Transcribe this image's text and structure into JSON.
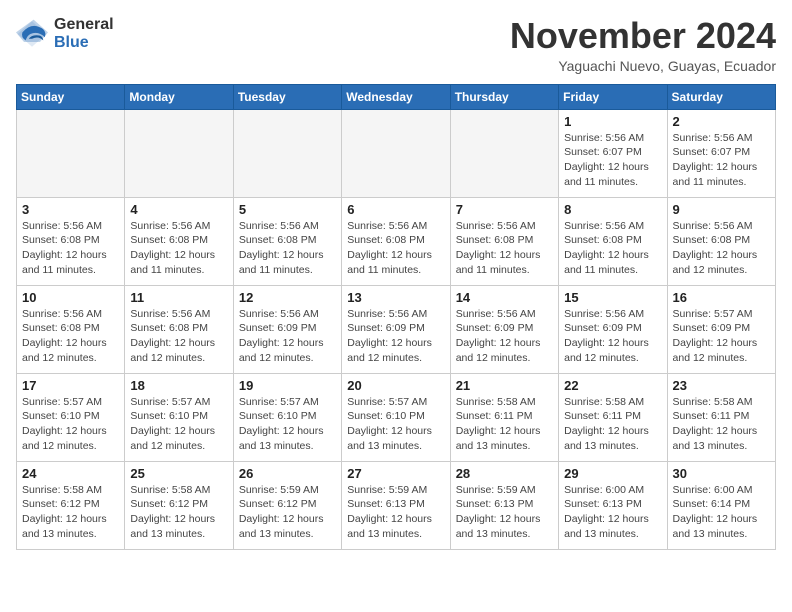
{
  "logo": {
    "general": "General",
    "blue": "Blue"
  },
  "title": "November 2024",
  "location": "Yaguachi Nuevo, Guayas, Ecuador",
  "days_of_week": [
    "Sunday",
    "Monday",
    "Tuesday",
    "Wednesday",
    "Thursday",
    "Friday",
    "Saturday"
  ],
  "weeks": [
    [
      {
        "day": "",
        "info": ""
      },
      {
        "day": "",
        "info": ""
      },
      {
        "day": "",
        "info": ""
      },
      {
        "day": "",
        "info": ""
      },
      {
        "day": "",
        "info": ""
      },
      {
        "day": "1",
        "info": "Sunrise: 5:56 AM\nSunset: 6:07 PM\nDaylight: 12 hours and 11 minutes."
      },
      {
        "day": "2",
        "info": "Sunrise: 5:56 AM\nSunset: 6:07 PM\nDaylight: 12 hours and 11 minutes."
      }
    ],
    [
      {
        "day": "3",
        "info": "Sunrise: 5:56 AM\nSunset: 6:08 PM\nDaylight: 12 hours and 11 minutes."
      },
      {
        "day": "4",
        "info": "Sunrise: 5:56 AM\nSunset: 6:08 PM\nDaylight: 12 hours and 11 minutes."
      },
      {
        "day": "5",
        "info": "Sunrise: 5:56 AM\nSunset: 6:08 PM\nDaylight: 12 hours and 11 minutes."
      },
      {
        "day": "6",
        "info": "Sunrise: 5:56 AM\nSunset: 6:08 PM\nDaylight: 12 hours and 11 minutes."
      },
      {
        "day": "7",
        "info": "Sunrise: 5:56 AM\nSunset: 6:08 PM\nDaylight: 12 hours and 11 minutes."
      },
      {
        "day": "8",
        "info": "Sunrise: 5:56 AM\nSunset: 6:08 PM\nDaylight: 12 hours and 11 minutes."
      },
      {
        "day": "9",
        "info": "Sunrise: 5:56 AM\nSunset: 6:08 PM\nDaylight: 12 hours and 12 minutes."
      }
    ],
    [
      {
        "day": "10",
        "info": "Sunrise: 5:56 AM\nSunset: 6:08 PM\nDaylight: 12 hours and 12 minutes."
      },
      {
        "day": "11",
        "info": "Sunrise: 5:56 AM\nSunset: 6:08 PM\nDaylight: 12 hours and 12 minutes."
      },
      {
        "day": "12",
        "info": "Sunrise: 5:56 AM\nSunset: 6:09 PM\nDaylight: 12 hours and 12 minutes."
      },
      {
        "day": "13",
        "info": "Sunrise: 5:56 AM\nSunset: 6:09 PM\nDaylight: 12 hours and 12 minutes."
      },
      {
        "day": "14",
        "info": "Sunrise: 5:56 AM\nSunset: 6:09 PM\nDaylight: 12 hours and 12 minutes."
      },
      {
        "day": "15",
        "info": "Sunrise: 5:56 AM\nSunset: 6:09 PM\nDaylight: 12 hours and 12 minutes."
      },
      {
        "day": "16",
        "info": "Sunrise: 5:57 AM\nSunset: 6:09 PM\nDaylight: 12 hours and 12 minutes."
      }
    ],
    [
      {
        "day": "17",
        "info": "Sunrise: 5:57 AM\nSunset: 6:10 PM\nDaylight: 12 hours and 12 minutes."
      },
      {
        "day": "18",
        "info": "Sunrise: 5:57 AM\nSunset: 6:10 PM\nDaylight: 12 hours and 12 minutes."
      },
      {
        "day": "19",
        "info": "Sunrise: 5:57 AM\nSunset: 6:10 PM\nDaylight: 12 hours and 13 minutes."
      },
      {
        "day": "20",
        "info": "Sunrise: 5:57 AM\nSunset: 6:10 PM\nDaylight: 12 hours and 13 minutes."
      },
      {
        "day": "21",
        "info": "Sunrise: 5:58 AM\nSunset: 6:11 PM\nDaylight: 12 hours and 13 minutes."
      },
      {
        "day": "22",
        "info": "Sunrise: 5:58 AM\nSunset: 6:11 PM\nDaylight: 12 hours and 13 minutes."
      },
      {
        "day": "23",
        "info": "Sunrise: 5:58 AM\nSunset: 6:11 PM\nDaylight: 12 hours and 13 minutes."
      }
    ],
    [
      {
        "day": "24",
        "info": "Sunrise: 5:58 AM\nSunset: 6:12 PM\nDaylight: 12 hours and 13 minutes."
      },
      {
        "day": "25",
        "info": "Sunrise: 5:58 AM\nSunset: 6:12 PM\nDaylight: 12 hours and 13 minutes."
      },
      {
        "day": "26",
        "info": "Sunrise: 5:59 AM\nSunset: 6:12 PM\nDaylight: 12 hours and 13 minutes."
      },
      {
        "day": "27",
        "info": "Sunrise: 5:59 AM\nSunset: 6:13 PM\nDaylight: 12 hours and 13 minutes."
      },
      {
        "day": "28",
        "info": "Sunrise: 5:59 AM\nSunset: 6:13 PM\nDaylight: 12 hours and 13 minutes."
      },
      {
        "day": "29",
        "info": "Sunrise: 6:00 AM\nSunset: 6:13 PM\nDaylight: 12 hours and 13 minutes."
      },
      {
        "day": "30",
        "info": "Sunrise: 6:00 AM\nSunset: 6:14 PM\nDaylight: 12 hours and 13 minutes."
      }
    ]
  ]
}
